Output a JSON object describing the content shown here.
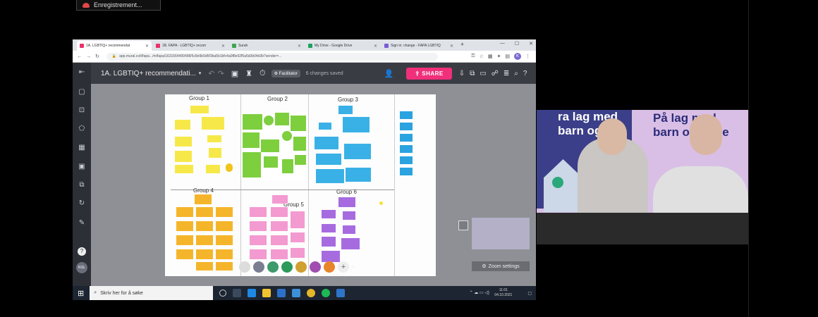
{
  "recording": {
    "label": "Enregistrement..."
  },
  "browser": {
    "tabs": [
      {
        "label": "1A. LGBTIQ+ recommendat",
        "color": "#e8326b"
      },
      {
        "label": "1B. FAPA - LGBTIQ+ recom",
        "color": "#e8326b"
      },
      {
        "label": "Surah",
        "color": "#3ea64f"
      },
      {
        "label": "My Drive - Google Drive",
        "color": "#1aa260"
      },
      {
        "label": "Sign in: change - FAPA LGBTIQ",
        "color": "#7a5bd6"
      }
    ],
    "url": "app.mural.co/t/fapa.../m/fapa/1631564499498/5c8e9b0d5f3ba5b1bfc4a0f8e92f5a5d3b04d3b?sender=...",
    "profile_initial": "K"
  },
  "mural": {
    "board_title": "1A. LGBTIQ+ recommendati...",
    "facilitator_label": "Facilitator",
    "save_status": "6 changes saved",
    "share_label": "SHARE",
    "user_initials": "KGL",
    "zoom_settings_label": "Zoom settings",
    "groups": [
      "Group 1",
      "Group 2",
      "Group 3",
      "Group 4",
      "Group 5",
      "Group 6"
    ]
  },
  "taskbar": {
    "search_placeholder": "Skriv her for å søke",
    "time": "11:01",
    "date": "04.10.2021"
  },
  "camera": {
    "poster_text_left": "ra lag med\nbarn og un",
    "poster_text_right": "På lag med\nbarn og unge"
  },
  "colors": {
    "share_button": "#f0307a",
    "sticky_yellow": "#f7e84a",
    "sticky_green": "#7dcf3e",
    "sticky_blue": "#3ab1e6",
    "sticky_orange": "#f5b52a",
    "sticky_pink": "#f39ad0",
    "sticky_purple": "#a76be0"
  }
}
